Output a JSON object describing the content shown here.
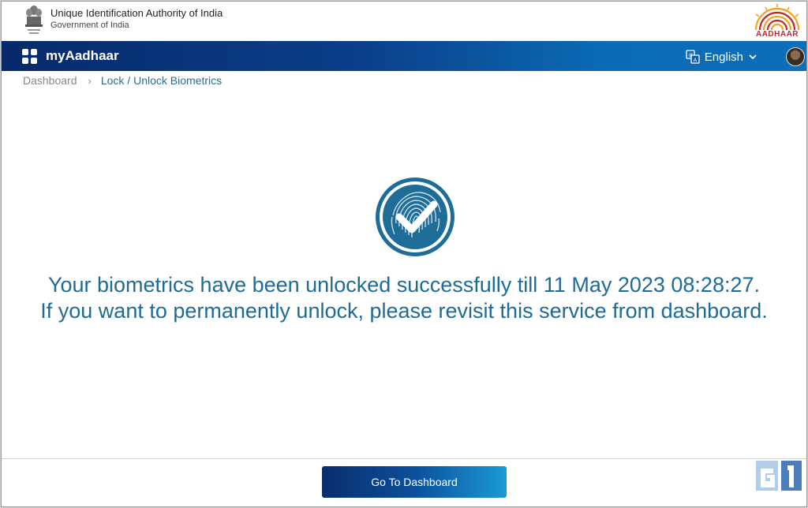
{
  "header": {
    "org_name": "Unique Identification Authority of India",
    "gov_name": "Government of India",
    "emblem_icon": "national-emblem-icon",
    "logo_text": "AADHAAR"
  },
  "navbar": {
    "brand": "myAadhaar",
    "menu_icon": "grid-menu-icon",
    "language_icon": "translate-icon",
    "language": "English",
    "avatar_icon": "user-avatar"
  },
  "breadcrumb": {
    "home": "Dashboard",
    "separator": "›",
    "current": "Lock / Unlock Biometrics"
  },
  "status": {
    "icon": "fingerprint-check-icon",
    "line1": "Your biometrics have been unlocked successfully till 11 May 2023 08:28:27.",
    "line2": "If you want to permanently unlock, please revisit this service from dashboard."
  },
  "footer": {
    "button_label": "Go To Dashboard"
  },
  "colors": {
    "nav_start": "#062a6b",
    "nav_end": "#0d6fb8",
    "message": "#1d6b96",
    "breadcrumb_active": "#2a6e91",
    "logo_red": "#c0272d"
  }
}
